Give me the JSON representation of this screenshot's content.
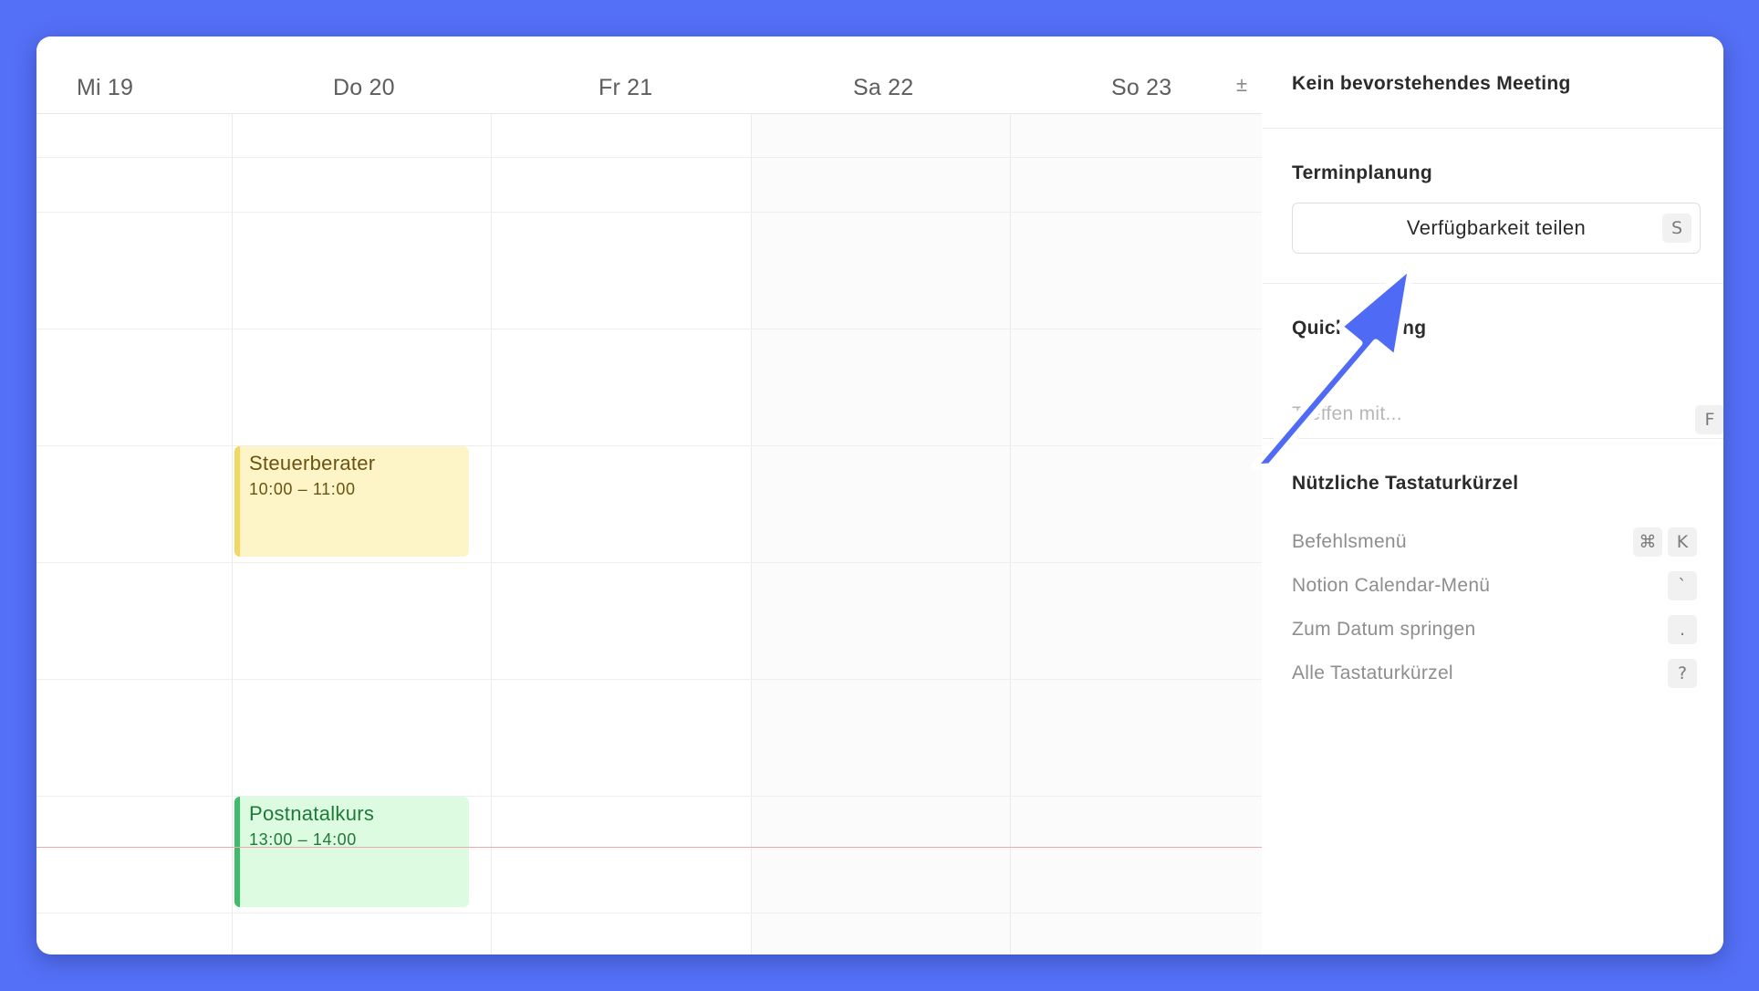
{
  "calendar": {
    "days": [
      {
        "label": "Mi 19"
      },
      {
        "label": "Do 20"
      },
      {
        "label": "Fr 21"
      },
      {
        "label": "Sa 22"
      },
      {
        "label": "So 23"
      }
    ],
    "timezone_toggle": "±",
    "events": [
      {
        "title": "Steuerberater",
        "time": "10:00 – 11:00",
        "color": "#fdf4c8",
        "accent": "#f2d760"
      },
      {
        "title": "Postnatalkurs",
        "time": "13:00 – 14:00",
        "color": "#dcfbe0",
        "accent": "#3cbd67"
      }
    ]
  },
  "panel": {
    "upcoming_heading": "Kein bevorstehendes Meeting",
    "scheduling_heading": "Terminplanung",
    "share_button_label": "Verfügbarkeit teilen",
    "share_button_key": "S",
    "quick_meeting_heading": "Quick Meeting",
    "quick_meeting_placeholder": "Treffen mit...",
    "quick_meeting_key": "F",
    "shortcuts_heading": "Nützliche Tastaturkürzel",
    "shortcuts": [
      {
        "label": "Befehlsmenü",
        "keys": [
          "⌘",
          "K"
        ]
      },
      {
        "label": "Notion Calendar-Menü",
        "keys": [
          "`"
        ]
      },
      {
        "label": "Zum Datum springen",
        "keys": [
          "."
        ]
      },
      {
        "label": "Alle Tastaturkürzel",
        "keys": [
          "?"
        ]
      }
    ]
  },
  "annotation": {
    "arrow_color": "#4f6af5"
  }
}
